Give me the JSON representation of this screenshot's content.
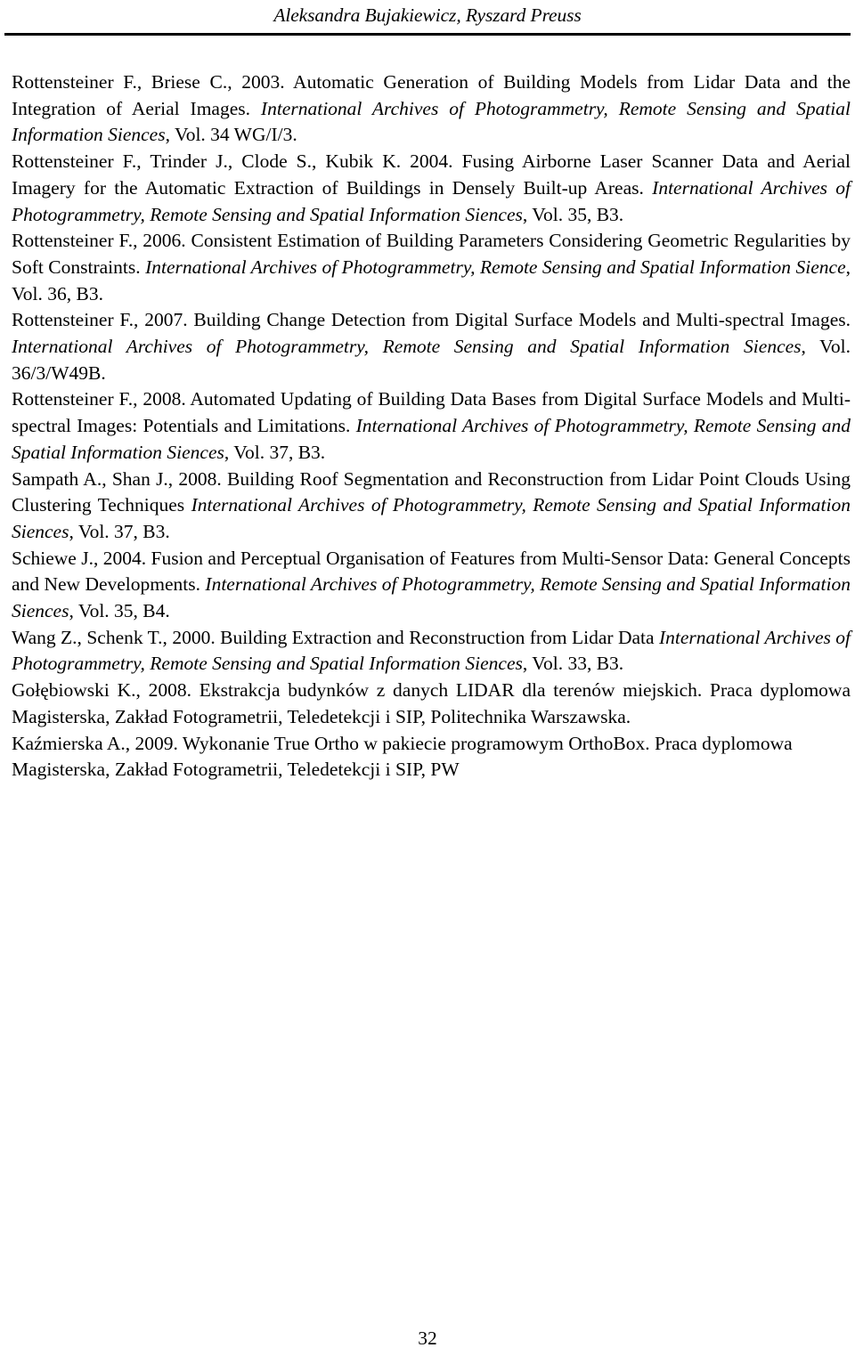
{
  "header": {
    "running_title": "Aleksandra Bujakiewicz, Ryszard Preuss"
  },
  "footer": {
    "page_number": "32"
  },
  "references": [
    {
      "id": "rottensteiner-briese-2003",
      "segments": [
        {
          "style": "roman",
          "text": "Rottensteiner F., Briese C., 2003. Automatic Generation of Building Models from Lidar Data and the Integration of Aerial Images. "
        },
        {
          "style": "italic",
          "text": "International Archives of Photogrammetry, Remote Sensing and Spatial Information Siences"
        },
        {
          "style": "roman",
          "text": ", Vol. 34 WG/I/3."
        }
      ]
    },
    {
      "id": "rottensteiner-2004",
      "segments": [
        {
          "style": "roman",
          "text": "Rottensteiner F., Trinder J., Clode S., Kubik K. 2004. Fusing Airborne Laser Scanner Data and Aerial Imagery for the Automatic Extraction of Buildings in Densely Built-up Areas. "
        },
        {
          "style": "italic",
          "text": "International Archives of Photogrammetry, Remote Sensing and Spatial Information Siences"
        },
        {
          "style": "roman",
          "text": ", Vol. 35, B3."
        }
      ]
    },
    {
      "id": "rottensteiner-2006",
      "segments": [
        {
          "style": "roman",
          "text": "Rottensteiner F., 2006. Consistent Estimation of Building Parameters Considering Geometric Regularities by Soft Constraints. "
        },
        {
          "style": "italic",
          "text": "International Archives of Photogrammetry, Remote Sensing and Spatial Information Sience"
        },
        {
          "style": "roman",
          "text": ", Vol. 36, B3."
        }
      ]
    },
    {
      "id": "rottensteiner-2007",
      "segments": [
        {
          "style": "roman",
          "text": "Rottensteiner F., 2007. Building Change Detection from Digital Surface Models and Multi-spectral Images. "
        },
        {
          "style": "italic",
          "text": "International Archives of Photogrammetry, Remote Sensing and Spatial Information Siences"
        },
        {
          "style": "roman",
          "text": ", Vol. 36/3/W49B."
        }
      ]
    },
    {
      "id": "rottensteiner-2008",
      "segments": [
        {
          "style": "roman",
          "text": "Rottensteiner F., 2008. Automated Updating of Building Data Bases from Digital Surface Models and Multi-spectral Images: Potentials and Limitations. "
        },
        {
          "style": "italic",
          "text": "International Archives of Photogrammetry, Remote Sensing and Spatial Information Siences"
        },
        {
          "style": "roman",
          "text": ", Vol. 37, B3."
        }
      ]
    },
    {
      "id": "sampath-shan-2008",
      "segments": [
        {
          "style": "roman",
          "text": "Sampath A., Shan J.,  2008. Building Roof Segmentation and Reconstruction from Lidar Point Clouds Using Clustering Techniques "
        },
        {
          "style": "italic",
          "text": "International Archives of Photogrammetry, Remote Sensing and Spatial Information Siences"
        },
        {
          "style": "roman",
          "text": ", Vol. 37, B3."
        }
      ]
    },
    {
      "id": "schiewe-2004",
      "segments": [
        {
          "style": "roman",
          "text": "Schiewe J., 2004. Fusion and Perceptual Organisation of Features from Multi-Sensor Data: General Concepts and New Developments. "
        },
        {
          "style": "italic",
          "text": "International Archives of Photogrammetry, Remote Sensing and Spatial Information Siences"
        },
        {
          "style": "roman",
          "text": ", Vol. 35, B4."
        }
      ]
    },
    {
      "id": "wang-schenk-2000",
      "segments": [
        {
          "style": "roman",
          "text": "Wang Z., Schenk T., 2000. Building Extraction and Reconstruction from Lidar Data "
        },
        {
          "style": "italic",
          "text": "International Archives of Photogrammetry, Remote Sensing and Spatial Information Siences"
        },
        {
          "style": "roman",
          "text": ", Vol. 33, B3."
        }
      ]
    },
    {
      "id": "golebiowski-2008",
      "segments": [
        {
          "style": "roman",
          "text": "Gołębiowski K., 2008. Ekstrakcja budynków z danych LIDAR dla terenów miejskich. Praca dyplomowa Magisterska, Zakład Fotogrametrii, Teledetekcji i SIP, Politechnika Warszawska."
        }
      ]
    },
    {
      "id": "kazmierska-2009",
      "segments": [
        {
          "style": "roman",
          "text": "Kaźmierska A., 2009. Wykonanie True Ortho w pakiecie programowym OrthoBox. Praca dyplomowa Magisterska, Zakład Fotogrametrii, Teledetekcji i SIP, PW"
        }
      ]
    }
  ]
}
